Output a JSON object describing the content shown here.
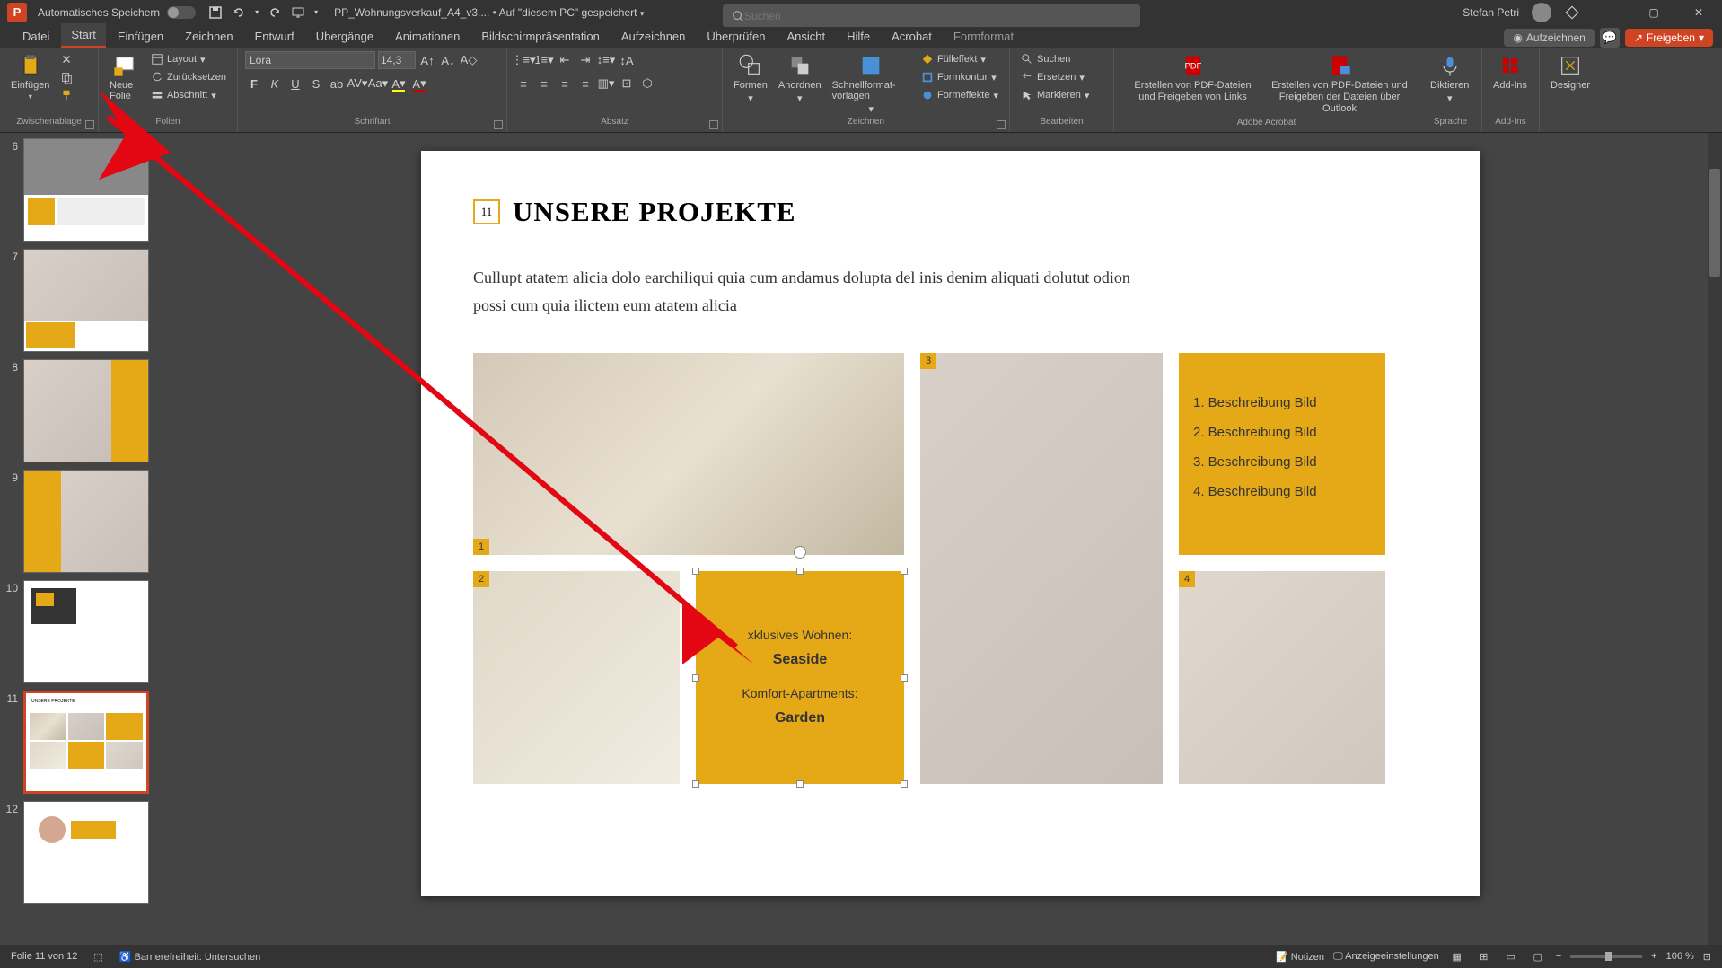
{
  "titlebar": {
    "auto_save": "Automatisches Speichern",
    "doc_name": "PP_Wohnungsverkauf_A4_v3....",
    "saved_location": "Auf \"diesem PC\" gespeichert",
    "search_placeholder": "Suchen",
    "user_name": "Stefan Petri"
  },
  "tabs": {
    "datei": "Datei",
    "start": "Start",
    "einfuegen": "Einfügen",
    "zeichnen": "Zeichnen",
    "entwurf": "Entwurf",
    "uebergaenge": "Übergänge",
    "animationen": "Animationen",
    "bildschirm": "Bildschirmpräsentation",
    "aufzeichnen": "Aufzeichnen",
    "ueberpruefen": "Überprüfen",
    "ansicht": "Ansicht",
    "hilfe": "Hilfe",
    "acrobat": "Acrobat",
    "formformat": "Formformat",
    "aufzeichnen_btn": "Aufzeichnen",
    "freigeben": "Freigeben"
  },
  "ribbon": {
    "einfuegen": "Einfügen",
    "zwischenablage": "Zwischenablage",
    "neue_folie": "Neue Folie",
    "layout": "Layout",
    "zuruecksetzen": "Zurücksetzen",
    "abschnitt": "Abschnitt",
    "folien": "Folien",
    "font_name": "Lora",
    "font_size": "14,3",
    "schriftart": "Schriftart",
    "absatz": "Absatz",
    "formen": "Formen",
    "anordnen": "Anordnen",
    "schnellformat": "Schnellformat-vorlagen",
    "fuelleffekt": "Fülleffekt",
    "formkontur": "Formkontur",
    "formeffekte": "Formeffekte",
    "zeichnen_grp": "Zeichnen",
    "suchen": "Suchen",
    "ersetzen": "Ersetzen",
    "markieren": "Markieren",
    "bearbeiten": "Bearbeiten",
    "pdf1": "Erstellen von PDF-Dateien und Freigeben von Links",
    "pdf2": "Erstellen von PDF-Dateien und Freigeben der Dateien über Outlook",
    "adobe": "Adobe Acrobat",
    "diktieren": "Diktieren",
    "sprache": "Sprache",
    "addins": "Add-Ins",
    "addins_grp": "Add-Ins",
    "designer": "Designer"
  },
  "thumbs": [
    "6",
    "7",
    "8",
    "9",
    "10",
    "11",
    "12"
  ],
  "slide": {
    "num": "11",
    "title": "UNSERE PROJEKTE",
    "desc": "Cullupt atatem alicia dolo earchiliqui quia cum andamus dolupta del inis denim aliquati dolutut odion possi cum quia ilictem eum atatem alicia",
    "labels": {
      "l1": "1",
      "l2": "2",
      "l3": "3",
      "l4": "4"
    },
    "desc_items": [
      "1. Beschreibung Bild",
      "2. Beschreibung Bild",
      "3. Beschreibung Bild",
      "4. Beschreibung Bild"
    ],
    "textbox": {
      "line1": "xklusives Wohnen:",
      "line2": "Seaside",
      "line3": "Komfort-Apartments:",
      "line4": "Garden"
    }
  },
  "status": {
    "slide_count": "Folie 11 von 12",
    "accessibility": "Barrierefreiheit: Untersuchen",
    "notizen": "Notizen",
    "anzeige": "Anzeigeeinstellungen",
    "zoom": "106 %"
  }
}
